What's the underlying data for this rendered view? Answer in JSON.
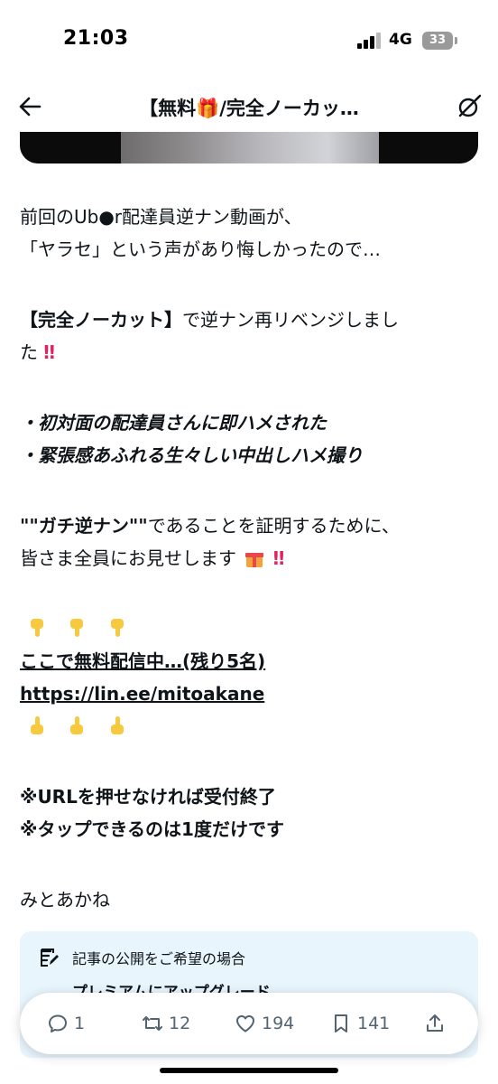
{
  "status_bar": {
    "time": "21:03",
    "network": "4G",
    "battery": "33"
  },
  "nav": {
    "title": "【無料🎁/完全ノーカッ…"
  },
  "article": {
    "p1_line1": "前回のUb●r配達員逆ナン動画が、",
    "p1_line2": "「ヤラセ」という声があり悔しかったので…",
    "p2_bold": "【完全ノーカット】",
    "p2_rest": "で逆ナン再リベンジしまし",
    "p2_line2": "た",
    "p2_mark": "‼",
    "bullet1": "・初対面の配達員さんに即ハメされた",
    "bullet2": "・緊張感あふれる生々しい中出しハメ撮り",
    "p4_bold": "\"\"ガチ逆ナン\"\"",
    "p4_rest": "であることを証明するために、",
    "p4_line2": "皆さま全員にお見せします",
    "p4_mark": "‼",
    "cta_link": "ここで無料配信中…(残り5名)",
    "url": "https://lin.ee/mitoakane",
    "note1": "※URLを押せなければ受付終了",
    "note2": "※タップできるのは1度だけです",
    "author": "みとあかね"
  },
  "upgrade": {
    "heading": "記事の公開をご希望の場合",
    "link": "プレミアムにアップグレード"
  },
  "actions": {
    "replies": "1",
    "reposts": "12",
    "likes": "194",
    "bookmarks": "141"
  },
  "icons": [
    "back-arrow-icon",
    "grok-icon",
    "gift-icon",
    "double-exclamation-icon",
    "pointing-down-icon",
    "pointing-up-icon",
    "compose-icon",
    "reply-icon",
    "repost-icon",
    "like-icon",
    "bookmark-icon",
    "share-icon"
  ],
  "colors": {
    "text": "#0f1419",
    "secondary": "#536471",
    "accent_red": "#e0245e",
    "upgrade_bg": "#e8f5fd"
  }
}
